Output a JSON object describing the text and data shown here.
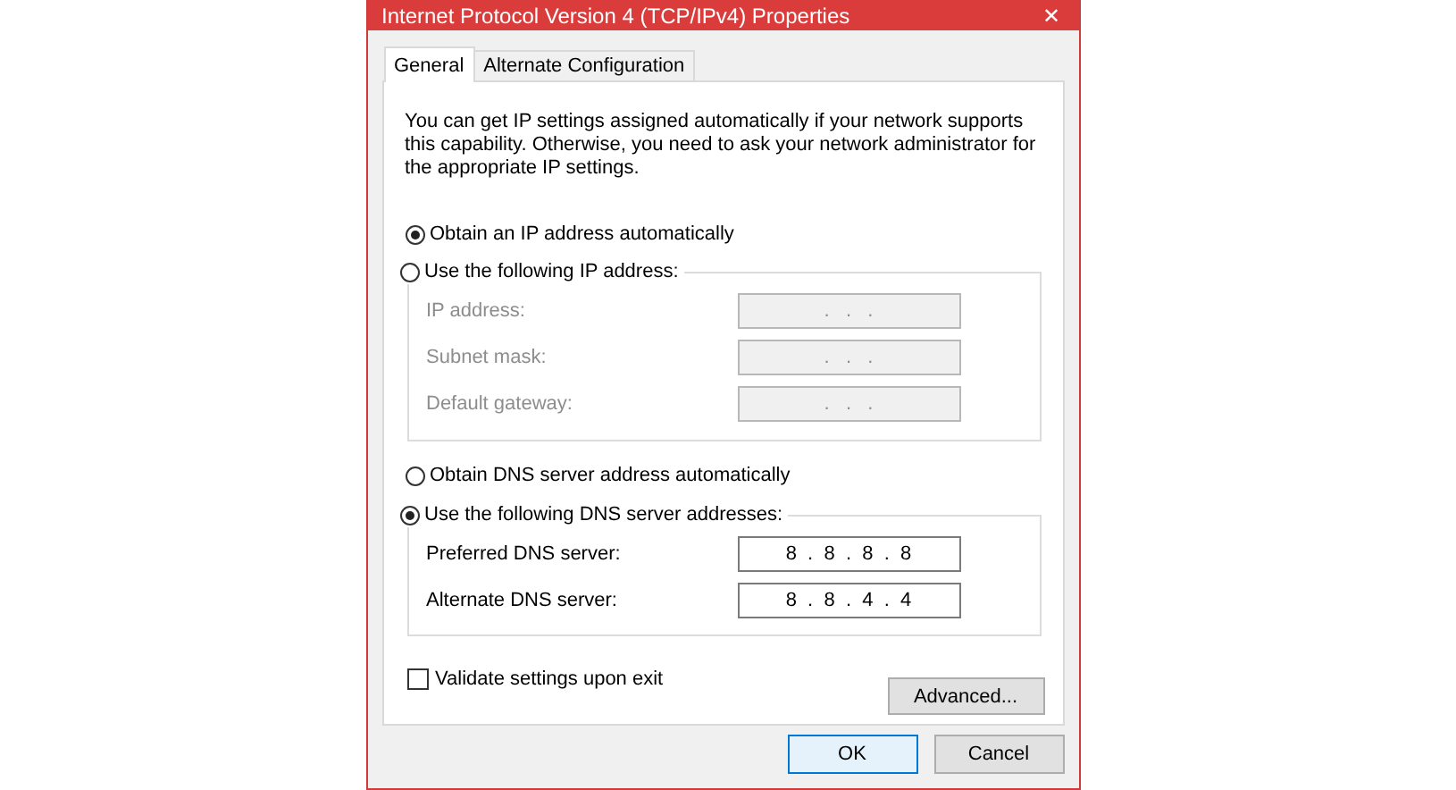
{
  "window": {
    "title": "Internet Protocol Version 4 (TCP/IPv4) Properties",
    "close": "✕"
  },
  "tabs": [
    {
      "label": "General",
      "selected": true
    },
    {
      "label": "Alternate Configuration",
      "selected": false
    }
  ],
  "intro": "You can get IP settings assigned automatically if your network supports this capability. Otherwise, you need to ask your network administrator for the appropriate IP settings.",
  "ip_options": [
    {
      "label": "Obtain an IP address automatically",
      "selected": true
    },
    {
      "label": "Use the following IP address:",
      "selected": false
    }
  ],
  "ip_fields": [
    {
      "label": "IP address:",
      "disabled": true,
      "value": ".   .   ."
    },
    {
      "label": "Subnet mask:",
      "disabled": true,
      "value": ".   .   ."
    },
    {
      "label": "Default gateway:",
      "disabled": true,
      "value": ".   .   ."
    }
  ],
  "dns_options": [
    {
      "label": "Obtain DNS server address automatically",
      "selected": false
    },
    {
      "label": "Use the following DNS server addresses:",
      "selected": true
    }
  ],
  "dns_fields": [
    {
      "label": "Preferred DNS server:",
      "disabled": false,
      "value": "8  .  8  .  8  .  8"
    },
    {
      "label": "Alternate DNS server:",
      "disabled": false,
      "value": "8  .  8  .  4  .  4"
    }
  ],
  "validate": {
    "label": "Validate settings upon exit",
    "checked": false
  },
  "advanced_button": "Advanced...",
  "buttons": [
    {
      "label": "OK",
      "default": true
    },
    {
      "label": "Cancel",
      "default": false
    }
  ]
}
